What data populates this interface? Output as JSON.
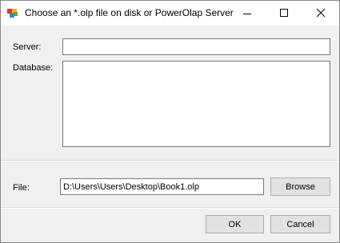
{
  "window": {
    "title": "Choose an *.olp file on disk or PowerOlap Server"
  },
  "form": {
    "server_label": "Server:",
    "server_value": "",
    "database_label": "Database:",
    "database_value": "",
    "file_label": "File:",
    "file_value": "D:\\Users\\Users\\Desktop\\Book1.olp",
    "browse_label": "Browse"
  },
  "buttons": {
    "ok_label": "OK",
    "cancel_label": "Cancel"
  },
  "icons": {
    "app": "window-app-icon",
    "minimize": "minimize-icon",
    "maximize": "maximize-icon",
    "close": "close-icon"
  }
}
